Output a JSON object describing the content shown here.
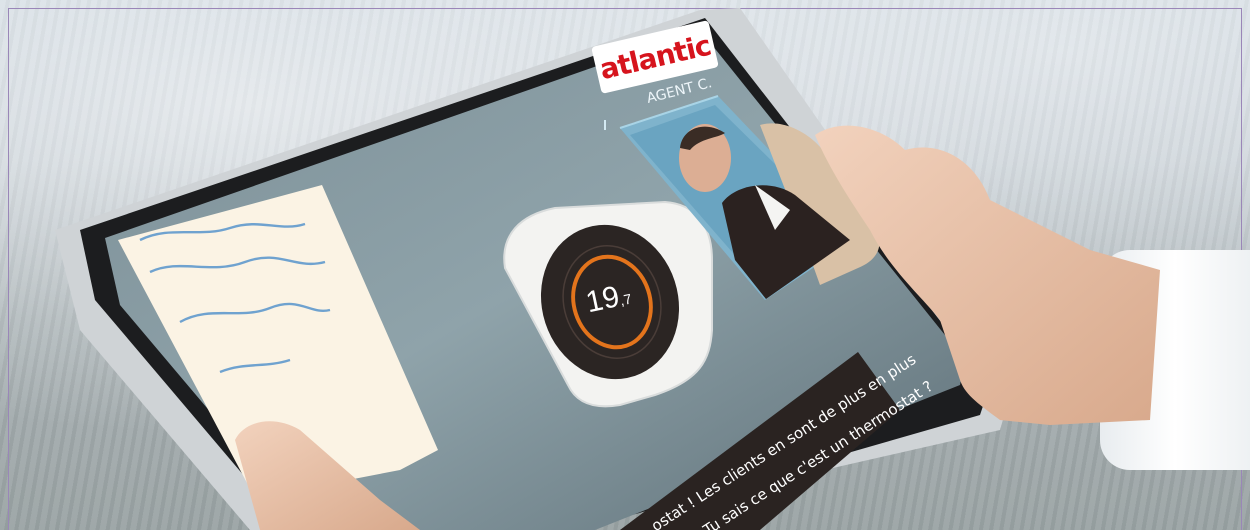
{
  "logo": {
    "text": "atlantic",
    "color": "#d6141d"
  },
  "agent": {
    "label": "AGENT C."
  },
  "thermostat": {
    "temperature": "19",
    "temperature_decimal": ",7"
  },
  "subtitles": {
    "line1": "ostat ! Les clients en sont de plus en plus",
    "line2": "Tu sais ce que c'est un thermostat ?"
  }
}
